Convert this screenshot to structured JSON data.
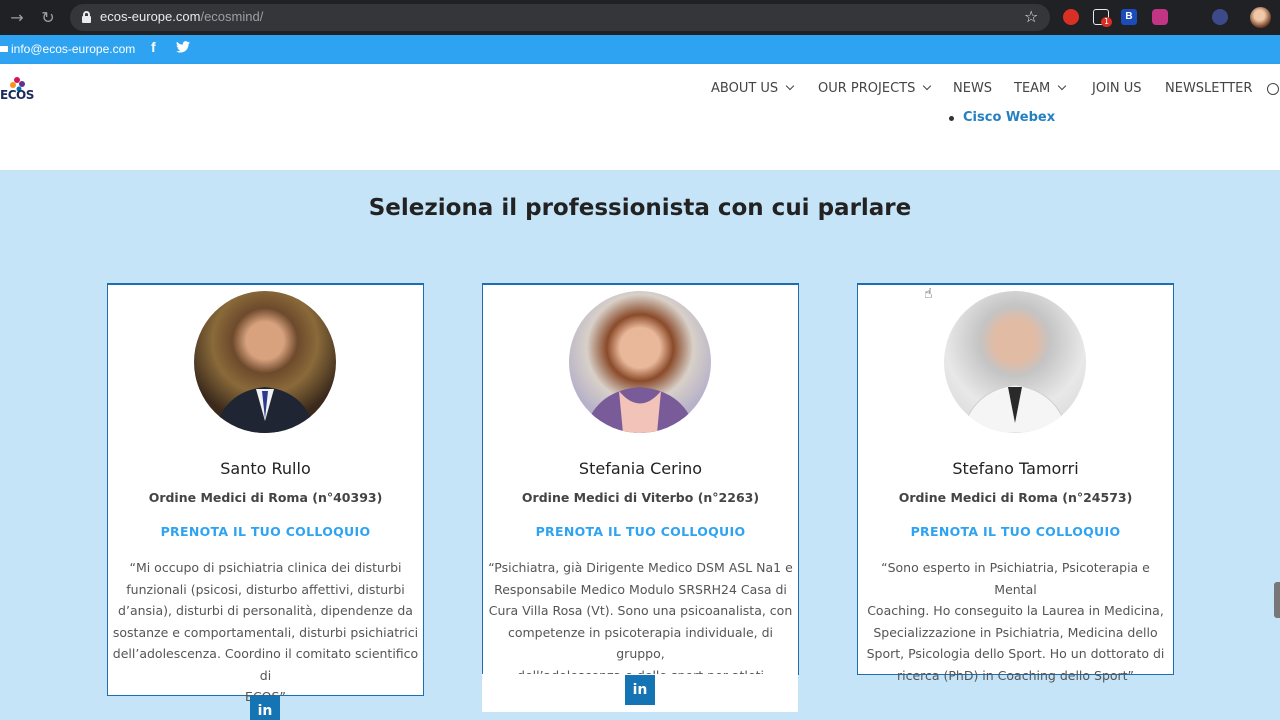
{
  "browser": {
    "url_host": "ecos-europe.com",
    "url_path": "/ecosmind/",
    "extension_badge": "1",
    "icons": [
      "back-arrow-icon",
      "reload-icon",
      "lock-icon",
      "star-icon",
      "profile-avatar"
    ]
  },
  "topbar": {
    "email": "info@ecos-europe.com",
    "facebook_glyph": "f",
    "icons": [
      "mail-icon",
      "facebook-icon",
      "twitter-icon"
    ],
    "color": "#2ea3f2"
  },
  "header": {
    "logo_text": "ECOS",
    "nav": [
      {
        "label": "ABOUT US",
        "dropdown": true
      },
      {
        "label": "OUR PROJECTS",
        "dropdown": true
      },
      {
        "label": "NEWS",
        "dropdown": false
      },
      {
        "label": "TEAM",
        "dropdown": true
      },
      {
        "label": "JOIN US",
        "dropdown": false
      },
      {
        "label": "NEWSLETTER",
        "dropdown": false
      }
    ]
  },
  "content": {
    "list_item": "Cisco Webex"
  },
  "section": {
    "title": "Seleziona il professionista con cui parlare",
    "background": "#c6e4f7",
    "cards": [
      {
        "name": "Santo Rullo",
        "order": "Ordine Medici di Roma (n°40393)",
        "book_label": "PRENOTA IL TUO COLLOQUIO",
        "bio_lines": [
          "“Mi occupo di psichiatria clinica dei disturbi",
          "funzionali (psicosi, disturbo affettivi, disturbi",
          "d’ansia), disturbi di personalità, dipendenze da",
          "sostanze e comportamentali, disturbi psichiatrici",
          "dell’adolescenza. Coordino il comitato scientifico di",
          "ECOS”"
        ],
        "linkedin_label": "in"
      },
      {
        "name": "Stefania Cerino",
        "order": "Ordine Medici di Viterbo (n°2263)",
        "book_label": "PRENOTA IL TUO COLLOQUIO",
        "bio_lines": [
          "“Psichiatra, già Dirigente Medico DSM ASL Na1 e",
          "Responsabile Medico Modulo SRSRH24 Casa di",
          "Cura Villa Rosa (Vt). Sono una psicoanalista, con",
          "competenze in psicoterapia individuale, di gruppo,",
          "dell’adolescenza e dello sport per atleti paralimpici”"
        ],
        "linkedin_label": "in"
      },
      {
        "name": "Stefano Tamorri",
        "order": "Ordine Medici di Roma (n°24573)",
        "book_label": "PRENOTA IL TUO COLLOQUIO",
        "bio_lines": [
          "“Sono esperto in Psichiatria, Psicoterapia e Mental",
          "Coaching. Ho conseguito la Laurea in Medicina,",
          "Specializzazione in Psichiatria, Medicina dello",
          "Sport, Psicologia dello Sport. Ho un dottorato di",
          "ricerca (PhD) in Coaching dello Sport”"
        ],
        "linkedin_label": null
      }
    ]
  }
}
